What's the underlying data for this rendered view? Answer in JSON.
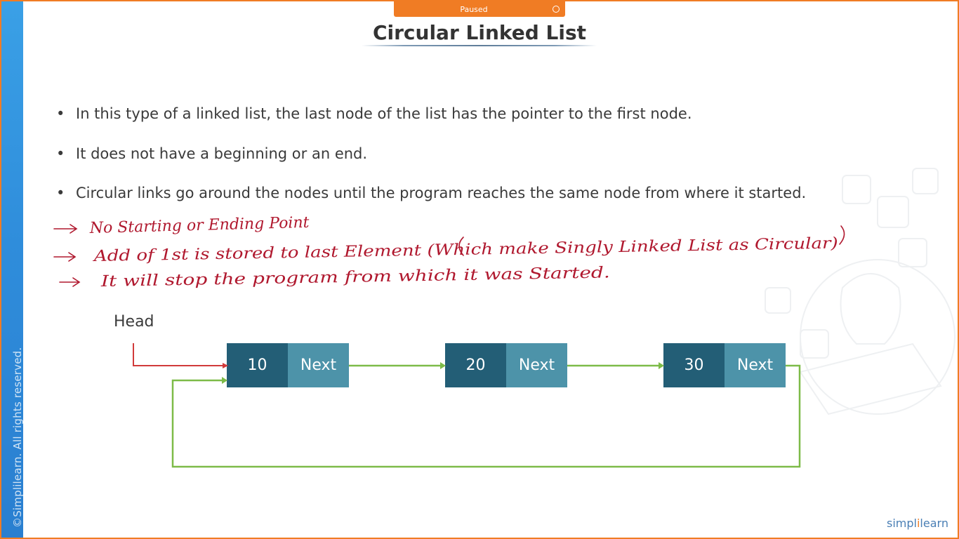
{
  "recording": {
    "status_label": "Paused",
    "record_icon": "record-circle-icon"
  },
  "slide": {
    "title": "Circular Linked List",
    "bullets": [
      "In this type of a linked list, the last node of the list has the pointer to the first node.",
      "It does not have a beginning or an end.",
      "Circular links go around the nodes until the program reaches the same node from where it started."
    ],
    "bullet_symbol": "•",
    "handwritten_notes": [
      "No Starting or Ending Point",
      "Add of 1st is stored to last Element (Which make Singly Linked List as Circular)",
      "It will stop the program from which it was Started."
    ],
    "diagram": {
      "head_label": "Head",
      "nodes": [
        {
          "value": "10",
          "next_label": "Next"
        },
        {
          "value": "20",
          "next_label": "Next"
        },
        {
          "value": "30",
          "next_label": "Next"
        }
      ]
    },
    "copyright": "©Simplilearn. All rights reserved.",
    "logo": {
      "part1": "simpl",
      "part2": "i",
      "part3": "learn"
    }
  },
  "colors": {
    "frame_border": "#f07c24",
    "side_strip": "#2f8ddb",
    "node_value_bg": "#235e76",
    "node_next_bg": "#4d93a9",
    "link_arrow": "#7dbb48",
    "head_arrow": "#d13b3b",
    "handwriting": "#b0182e"
  }
}
